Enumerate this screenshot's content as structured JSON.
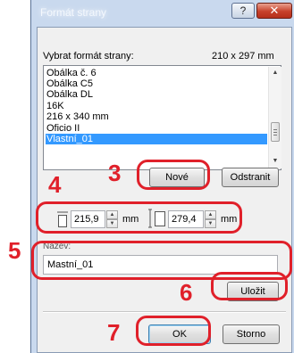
{
  "dialog": {
    "title": "Formát strany",
    "help_label": "?",
    "close_label": "✕"
  },
  "format_list": {
    "label": "Vybrat formát strany:",
    "size_value": "210 x 297 mm",
    "items": [
      "Obálka č. 6",
      "Obálka C5",
      "Obálka DL",
      "16K",
      "216 x 340 mm",
      "Oficio II",
      "Vlastní_01"
    ],
    "selected_index": 6
  },
  "buttons": {
    "new": "Nové",
    "delete": "Odstranit",
    "save": "Uložit",
    "ok": "OK",
    "cancel": "Storno"
  },
  "dimensions": {
    "width_value": "215,9",
    "height_value": "279,4",
    "unit": "mm"
  },
  "name_field": {
    "label": "Název:",
    "value": "Mastní_01"
  },
  "annotations": [
    "3",
    "4",
    "5",
    "6",
    "7"
  ],
  "colors": {
    "annotation_red": "#e0202a",
    "selection_blue": "#3399ff",
    "window_frame": "#c9d9ee"
  },
  "icons": [
    "help-icon",
    "close-icon",
    "width-dimension-icon",
    "height-dimension-icon"
  ]
}
